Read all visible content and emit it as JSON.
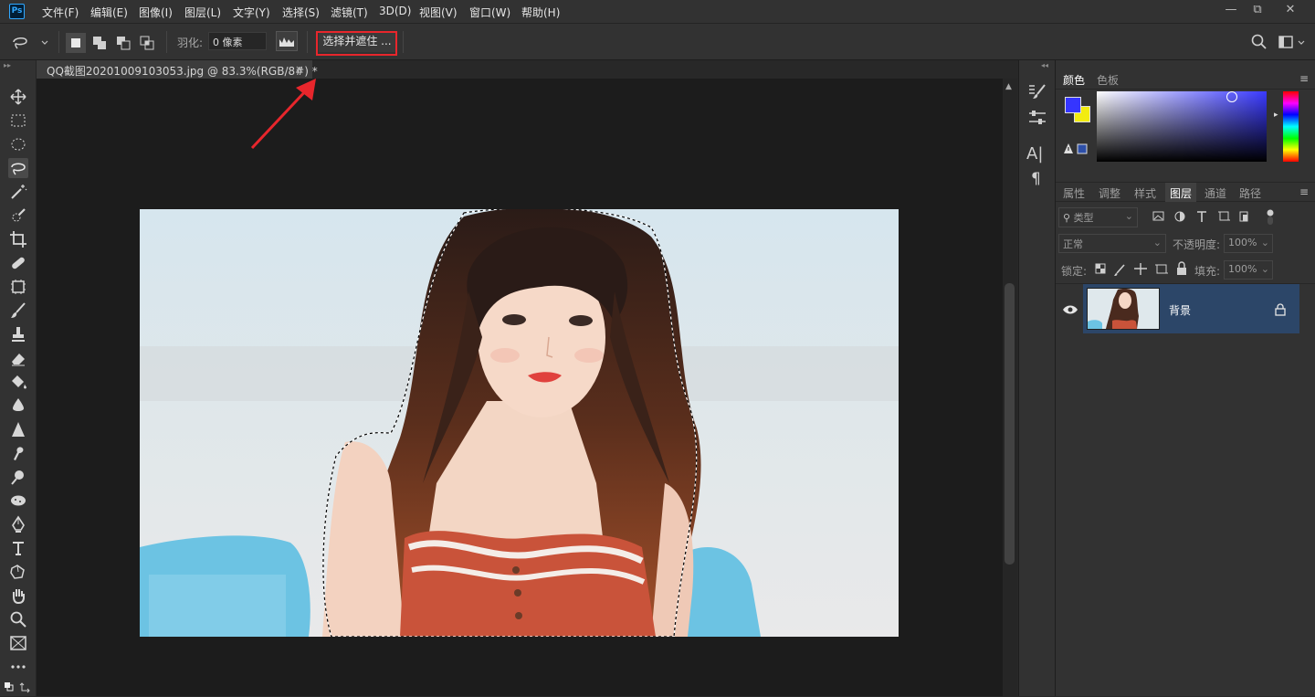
{
  "app": {
    "logo": "Ps"
  },
  "menu": [
    "文件(F)",
    "编辑(E)",
    "图像(I)",
    "图层(L)",
    "文字(Y)",
    "选择(S)",
    "滤镜(T)",
    "3D(D)",
    "视图(V)",
    "窗口(W)",
    "帮助(H)"
  ],
  "window": {
    "minimize": "—",
    "restore": "⧉",
    "close": "✕"
  },
  "options": {
    "feather_label": "羽化:",
    "feather_value": "0 像素",
    "select_mask_label": "选择并遮住 ..."
  },
  "document": {
    "tab_title": "QQ截图20201009103053.jpg @ 83.3%(RGB/8#) *",
    "close": "×"
  },
  "color_panel": {
    "tabs": [
      "颜色",
      "色板"
    ],
    "foreground": "#3535ff",
    "background": "#f2ec10"
  },
  "layers_panel": {
    "tabs": [
      "属性",
      "调整",
      "样式",
      "图层",
      "通道",
      "路径"
    ],
    "active_tab": "图层",
    "filter_placeholder": "类型",
    "blend_mode": "正常",
    "opacity_label": "不透明度:",
    "opacity_value": "100%",
    "lock_label": "锁定:",
    "fill_label": "填充:",
    "fill_value": "100%",
    "layers": [
      {
        "name": "背景",
        "locked": true,
        "visible": true
      }
    ]
  },
  "colors": {
    "highlight_red": "#e8262c",
    "selected_layer": "#2c4668"
  }
}
